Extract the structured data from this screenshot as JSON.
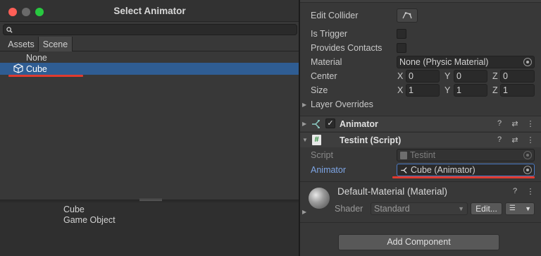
{
  "inspector": {
    "collider": {
      "edit_collider_label": "Edit Collider",
      "is_trigger_label": "Is Trigger",
      "provides_contacts_label": "Provides Contacts",
      "material_label": "Material",
      "material_value": "None (Physic Material)",
      "center_label": "Center",
      "center": {
        "x_label": "X",
        "x": "0",
        "y_label": "Y",
        "y": "0",
        "z_label": "Z",
        "z": "0"
      },
      "size_label": "Size",
      "size": {
        "x_label": "X",
        "x": "1",
        "y_label": "Y",
        "y": "1",
        "z_label": "Z",
        "z": "1"
      },
      "layer_overrides_label": "Layer Overrides"
    },
    "animator_component": {
      "title": "Animator",
      "enabled": true
    },
    "testint_component": {
      "title": "Testint (Script)",
      "script_label": "Script",
      "script_value": "Testint",
      "animator_label": "Animator",
      "animator_value": "Cube (Animator)"
    },
    "material_component": {
      "title": "Default-Material (Material)",
      "shader_label": "Shader",
      "shader_value": "Standard",
      "edit_label": "Edit..."
    },
    "add_component_label": "Add Component"
  },
  "select_window": {
    "title": "Select Animator",
    "search_value": "",
    "tabs": [
      {
        "label": "Assets",
        "active": false
      },
      {
        "label": "Scene",
        "active": true
      }
    ],
    "items": [
      {
        "label": "None",
        "selected": false
      },
      {
        "label": "Cube",
        "selected": true
      }
    ],
    "preview": {
      "name": "Cube",
      "type": "Game Object"
    }
  },
  "colors": {
    "selection": "#2f5d93",
    "highlight_underline": "#e03a2f",
    "label_blue": "#7ea6e6",
    "traffic_close": "#ff5f57",
    "traffic_minimize": "#febc2e",
    "traffic_zoom": "#28c840"
  }
}
